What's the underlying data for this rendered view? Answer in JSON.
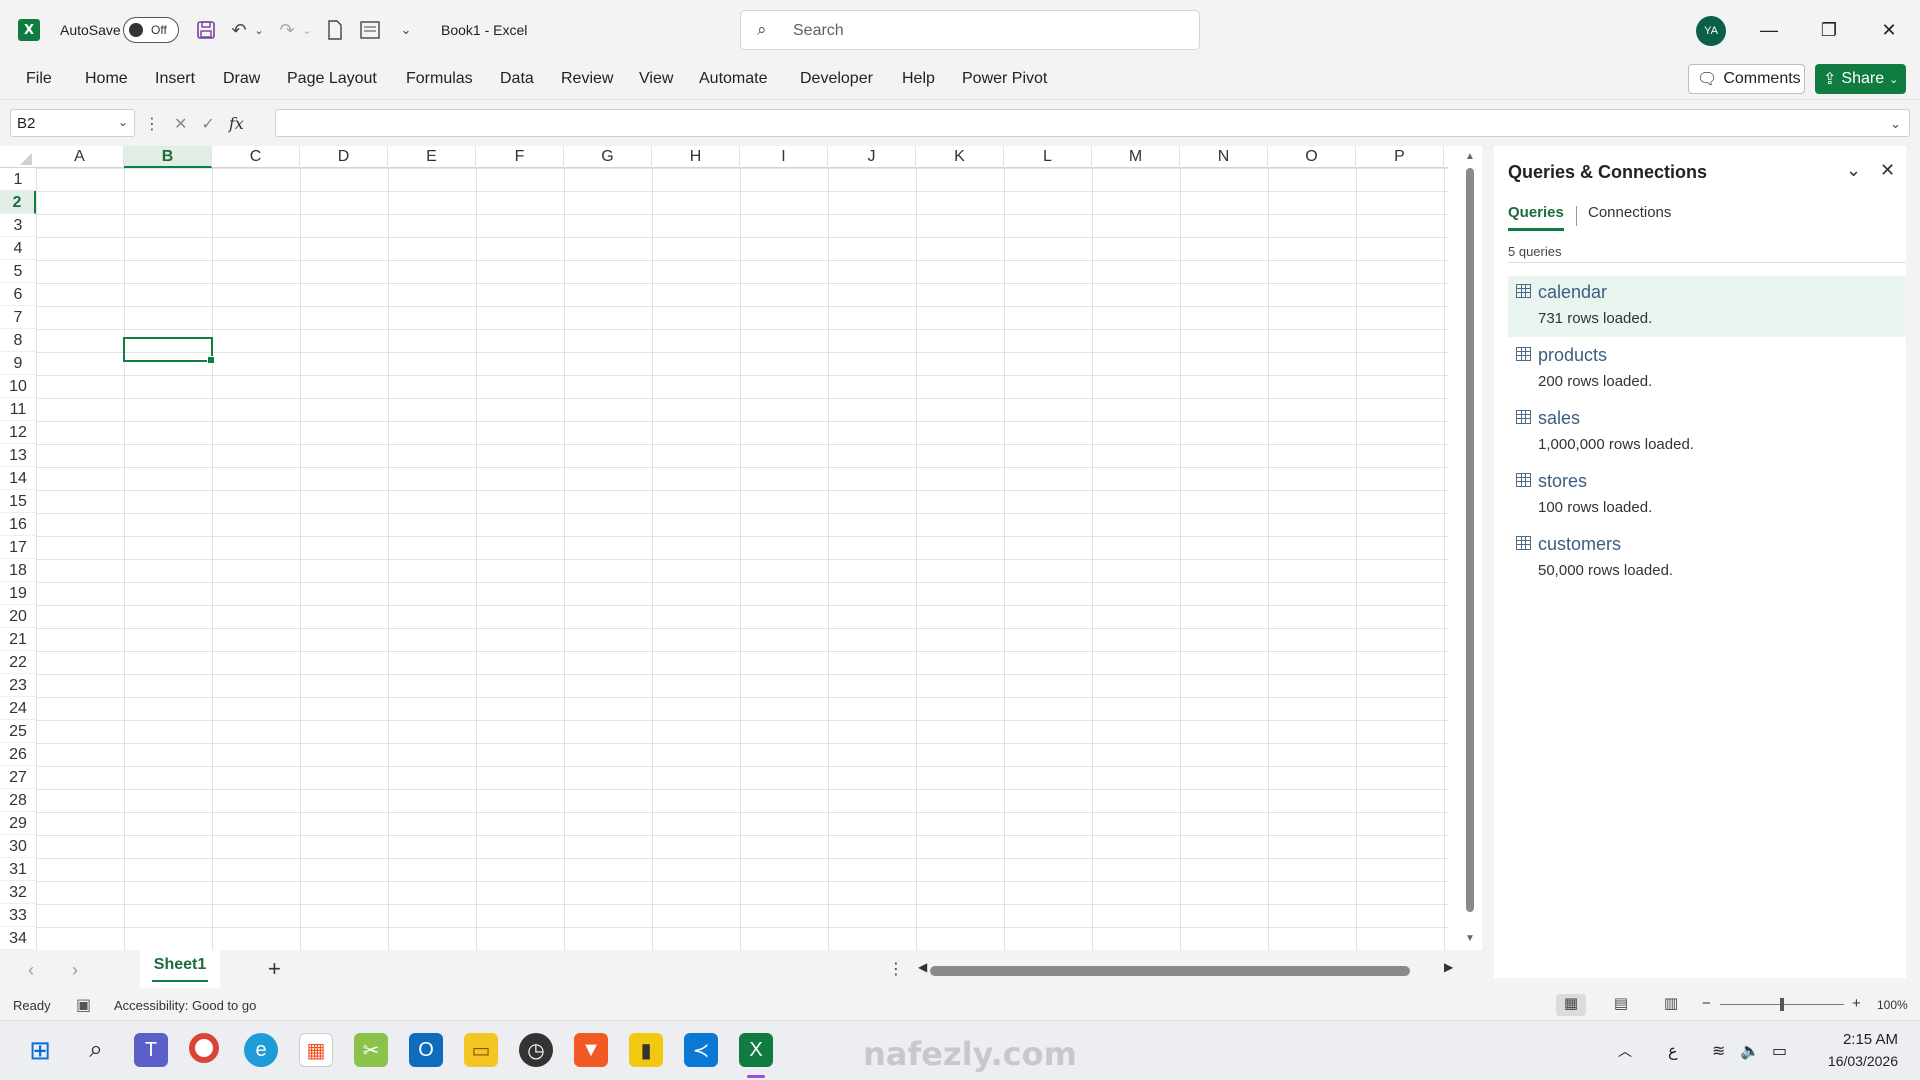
{
  "app": {
    "autosave_label": "AutoSave",
    "autosave_state": "Off",
    "doc_title": "Book1  -  Excel",
    "search_placeholder": "Search",
    "avatar_initials": "YA",
    "accent_color": "#107c41"
  },
  "ribbon": {
    "tabs": [
      "File",
      "Home",
      "Insert",
      "Draw",
      "Page Layout",
      "Formulas",
      "Data",
      "Review",
      "View",
      "Automate",
      "Developer",
      "Help",
      "Power Pivot"
    ],
    "comments_label": "Comments",
    "share_label": "Share"
  },
  "formula_bar": {
    "name_box": "B2",
    "fx_label": "fx",
    "formula_value": ""
  },
  "grid": {
    "columns": [
      "A",
      "B",
      "C",
      "D",
      "E",
      "F",
      "G",
      "H",
      "I",
      "J",
      "K",
      "L",
      "M",
      "N",
      "O",
      "P"
    ],
    "rows": [
      "1",
      "2",
      "3",
      "4",
      "5",
      "6",
      "7",
      "8",
      "9",
      "10",
      "11",
      "12",
      "13",
      "14",
      "15",
      "16",
      "17",
      "18",
      "19",
      "20",
      "21",
      "22",
      "23",
      "24",
      "25",
      "26",
      "27",
      "28",
      "29",
      "30",
      "31",
      "32",
      "33",
      "34"
    ],
    "selected_column": "B",
    "selected_row": "2"
  },
  "sheets": {
    "tabs": [
      "Sheet1"
    ],
    "add_label": "+"
  },
  "queries_pane": {
    "title": "Queries & Connections",
    "tabs": [
      "Queries",
      "Connections"
    ],
    "count_label": "5 queries",
    "queries": [
      {
        "name": "calendar",
        "status": "731 rows loaded."
      },
      {
        "name": "products",
        "status": "200 rows loaded."
      },
      {
        "name": "sales",
        "status": "1,000,000 rows loaded."
      },
      {
        "name": "stores",
        "status": "100 rows loaded."
      },
      {
        "name": "customers",
        "status": "50,000 rows loaded."
      }
    ]
  },
  "statusbar": {
    "ready": "Ready",
    "accessibility": "Accessibility: Good to go",
    "zoom": "100%"
  },
  "taskbar": {
    "time": "2:15 AM",
    "date": "16/03/2026",
    "lang": "ع"
  },
  "watermark": {
    "text": "nafezly.com"
  }
}
